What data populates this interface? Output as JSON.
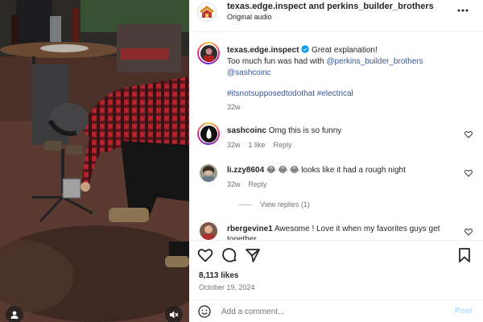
{
  "post": {
    "header_names": "texas.edge.inspect and perkins_builder_brothers",
    "audio": "Original audio"
  },
  "caption": {
    "username": "texas.edge.inspect",
    "verified": true,
    "line1": "Great explanation!",
    "line2_prefix": "Too much fun was had with ",
    "mention1": "@perkins_builder_brothers",
    "mention2": "@sashcoinc",
    "hashtags": "#itsnotsupposedtodothat #electrical",
    "time": "32w"
  },
  "comments": [
    {
      "username": "sashcoinc",
      "text": "Omg this is so funny",
      "time": "32w",
      "likes": "1 like",
      "reply": "Reply"
    },
    {
      "username": "li.zzy8604",
      "text": "😂 😂 😂 looks like it had a rough night",
      "time": "32w",
      "reply": "Reply",
      "view_replies": "View replies (1)"
    },
    {
      "username": "rbergevine1",
      "text": "Awesome ! Love it when my favorites guys get",
      "text2": "together"
    }
  ],
  "stats": {
    "likes": "8,113 likes",
    "date": "October 19, 2024"
  },
  "comment_box": {
    "placeholder": "Add a comment...",
    "post_label": "Post"
  },
  "icons": [
    "more-icon",
    "verified-icon",
    "heart-icon",
    "comment-icon",
    "share-icon",
    "bookmark-icon",
    "emoji-icon",
    "user-tag-icon",
    "muted-icon"
  ],
  "colors": {
    "link": "#385898",
    "post_button": "#b3dbff",
    "verified": "#0095f6"
  }
}
